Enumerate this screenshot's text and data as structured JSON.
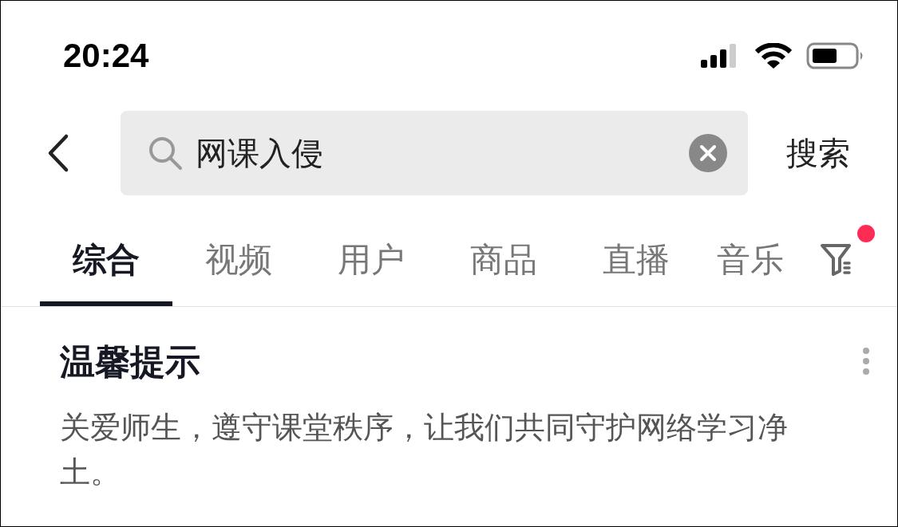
{
  "status_bar": {
    "time": "20:24"
  },
  "search": {
    "value": "网课入侵",
    "submit": "搜索"
  },
  "tabs": [
    {
      "label": "综合",
      "selected": true
    },
    {
      "label": "视频",
      "selected": false
    },
    {
      "label": "用户",
      "selected": false
    },
    {
      "label": "商品",
      "selected": false
    },
    {
      "label": "直播",
      "selected": false
    },
    {
      "label": "音乐",
      "selected": false
    }
  ],
  "filter": {
    "badge": true
  },
  "notice": {
    "title": "温馨提示",
    "text": "关爱师生，遵守课堂秩序，让我们共同守护网络学习净土。"
  }
}
